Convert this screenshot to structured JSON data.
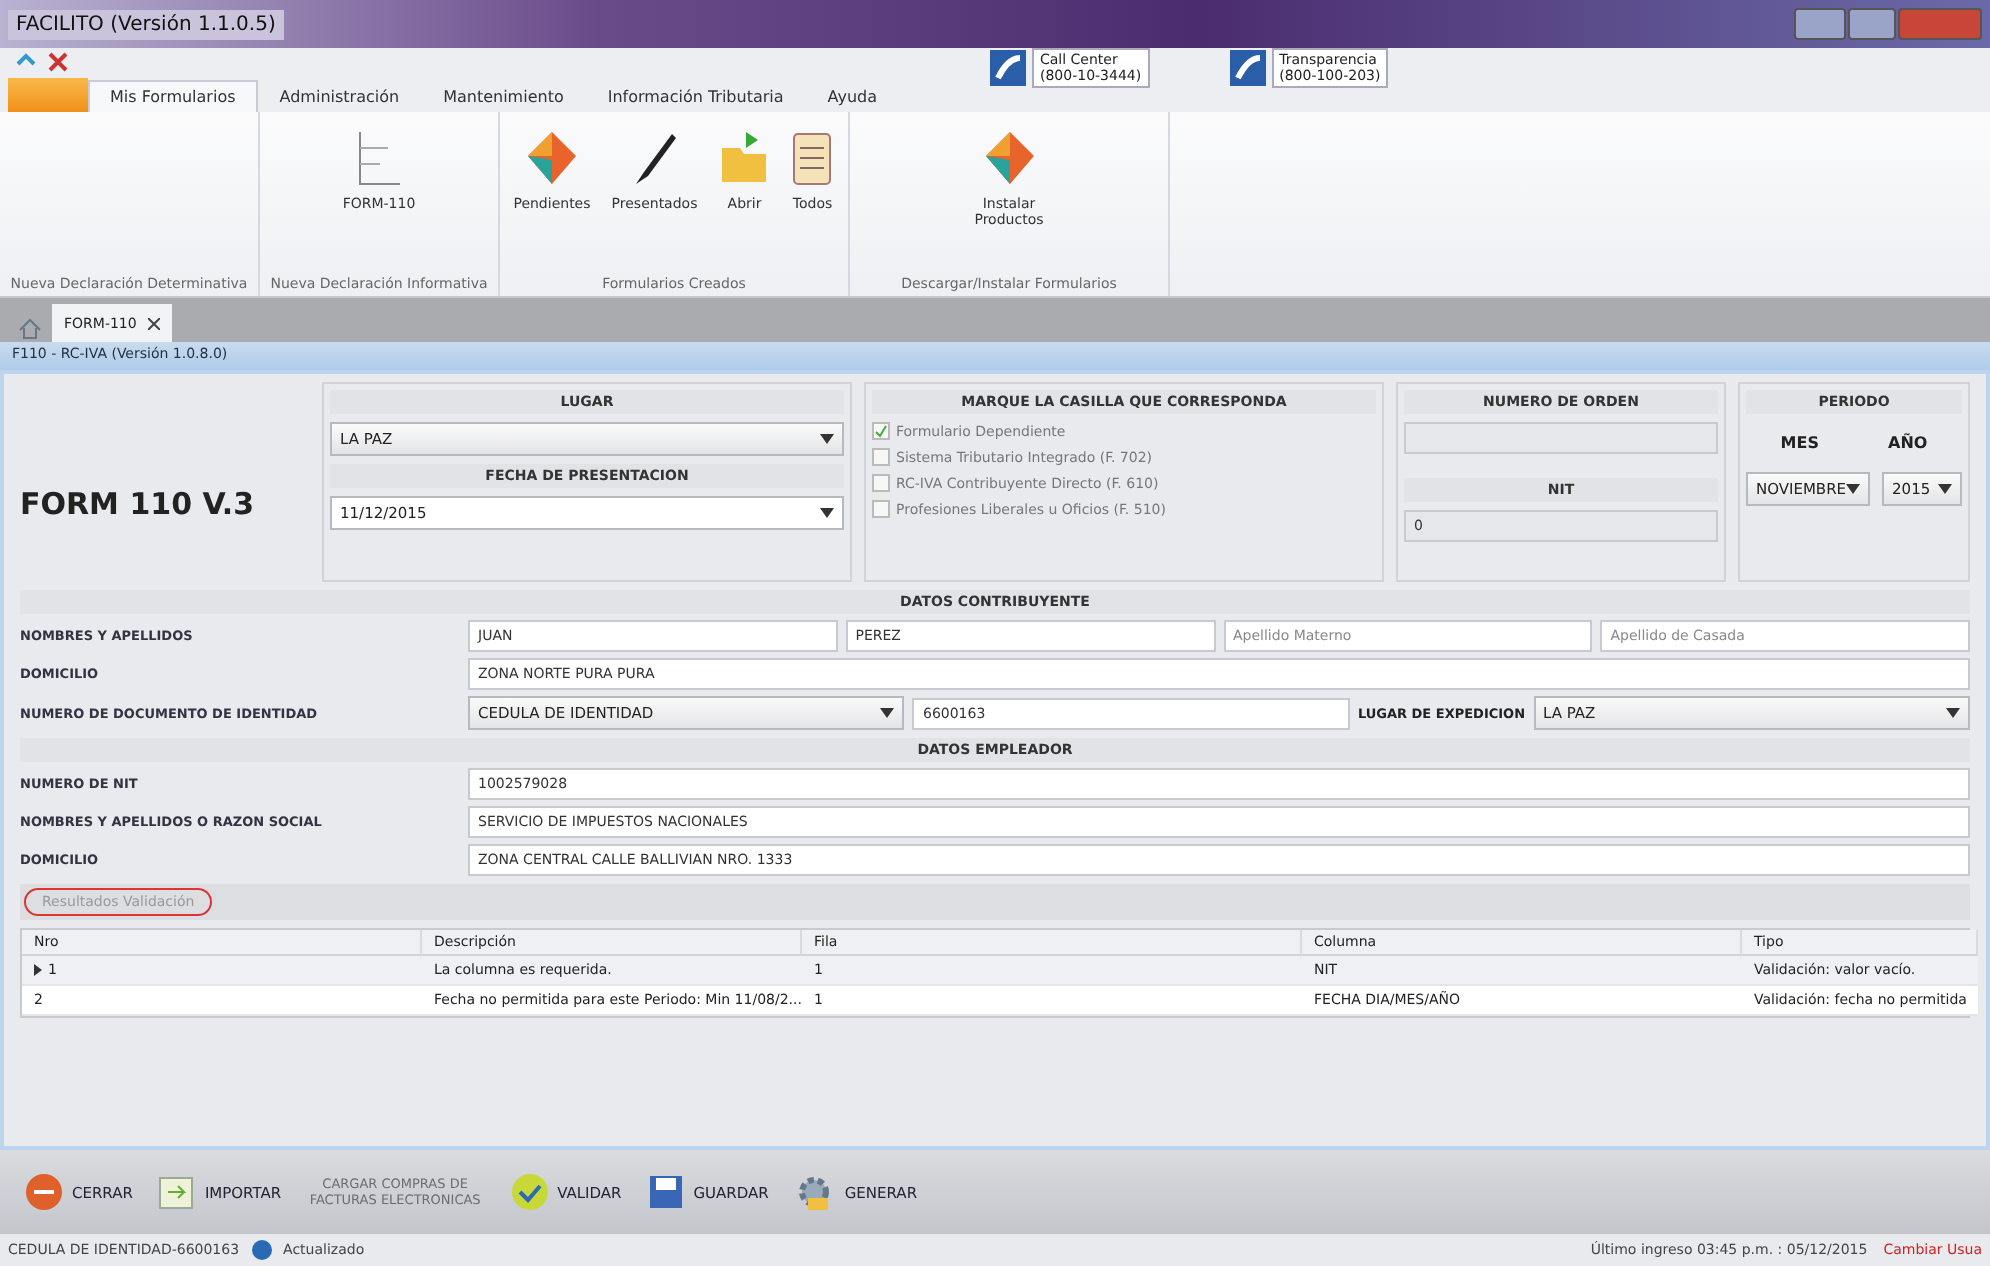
{
  "window": {
    "title": "FACILITO (Versión 1.1.0.5)"
  },
  "ribbon_tabs": [
    {
      "label": "Mis Formularios",
      "selected": true
    },
    {
      "label": "Administración",
      "selected": false
    },
    {
      "label": "Mantenimiento",
      "selected": false
    },
    {
      "label": "Información Tributaria",
      "selected": false
    },
    {
      "label": "Ayuda",
      "selected": false
    }
  ],
  "contacts": [
    {
      "title": "Call Center",
      "phone": "(800-10-3444)"
    },
    {
      "title": "Transparencia",
      "phone": "(800-100-203)"
    }
  ],
  "ribbon_groups": [
    {
      "label": "Nueva Declaración Determinativa"
    },
    {
      "label": "Nueva Declaración Informativa",
      "buttons": [
        {
          "label": "FORM-110",
          "kind": "form"
        }
      ]
    },
    {
      "label": "Formularios Creados",
      "buttons": [
        {
          "label": "Pendientes",
          "kind": "diamond"
        },
        {
          "label": "Presentados",
          "kind": "pen"
        },
        {
          "label": "Abrir",
          "kind": "folder"
        },
        {
          "label": "Todos",
          "kind": "list"
        }
      ]
    },
    {
      "label": "Descargar/Instalar Formularios",
      "buttons": [
        {
          "label": "Instalar Productos",
          "kind": "diamond"
        }
      ]
    }
  ],
  "doc_tabs": [
    {
      "label": "FORM-110",
      "selected": true
    }
  ],
  "form_header": "F110 - RC-IVA (Versión 1.0.8.0)",
  "form": {
    "title": "FORM 110 V.3",
    "lugar": {
      "label": "LUGAR",
      "value": "LA PAZ"
    },
    "fecha": {
      "label": "FECHA DE PRESENTACION",
      "value": "11/12/2015"
    },
    "casillas": {
      "label": "MARQUE LA CASILLA QUE CORRESPONDA",
      "options": [
        {
          "label": "Formulario Dependiente",
          "checked": true
        },
        {
          "label": "Sistema Tributario Integrado (F. 702)",
          "checked": false
        },
        {
          "label": "RC-IVA Contribuyente Directo (F. 610)",
          "checked": false
        },
        {
          "label": "Profesiones Liberales u Oficios (F. 510)",
          "checked": false
        }
      ]
    },
    "orden": {
      "label": "NUMERO DE ORDEN"
    },
    "nit": {
      "label": "NIT",
      "value": "0"
    },
    "periodo": {
      "label": "PERIODO",
      "mes_label": "MES",
      "anio_label": "AÑO",
      "mes": "NOVIEMBRE",
      "anio": "2015"
    }
  },
  "contribuyente": {
    "title": "DATOS CONTRIBUYENTE",
    "rows": [
      {
        "label": "NOMBRES Y APELLIDOS",
        "fields": [
          {
            "kind": "text",
            "value": "JUAN"
          },
          {
            "kind": "text",
            "value": "PEREZ"
          },
          {
            "kind": "text",
            "placeholder": "Apellido Materno"
          },
          {
            "kind": "text",
            "placeholder": "Apellido de Casada"
          }
        ]
      },
      {
        "label": "DOMICILIO",
        "fields": [
          {
            "kind": "text",
            "value": "ZONA NORTE PURA PURA"
          }
        ]
      },
      {
        "label": "NUMERO DE DOCUMENTO DE IDENTIDAD",
        "fields": [
          {
            "kind": "select",
            "value": "CEDULA DE IDENTIDAD"
          },
          {
            "kind": "text",
            "value": "6600163"
          },
          {
            "kind": "label",
            "value": "LUGAR DE EXPEDICION"
          },
          {
            "kind": "select",
            "value": "LA PAZ"
          }
        ]
      }
    ]
  },
  "empleador": {
    "title": "DATOS EMPLEADOR",
    "rows": [
      {
        "label": "NUMERO DE NIT",
        "fields": [
          {
            "kind": "text",
            "value": "1002579028"
          }
        ]
      },
      {
        "label": "NOMBRES Y APELLIDOS O RAZON SOCIAL",
        "fields": [
          {
            "kind": "text",
            "value": "SERVICIO DE IMPUESTOS NACIONALES"
          }
        ]
      },
      {
        "label": "DOMICILIO",
        "fields": [
          {
            "kind": "text",
            "value": "ZONA CENTRAL CALLE BALLIVIAN NRO. 1333"
          }
        ]
      }
    ]
  },
  "validation": {
    "title": "Resultados Validación",
    "columns": [
      "Nro",
      "Descripción",
      "Fila",
      "Columna",
      "Tipo"
    ],
    "rows": [
      {
        "selected": true,
        "cells": [
          "1",
          "La columna es requerida.",
          "1",
          "NIT",
          "Validación: valor vacío."
        ]
      },
      {
        "selected": false,
        "cells": [
          "2",
          "Fecha no permitida para este Periodo: Min 11/08/2...",
          "1",
          "FECHA DIA/MES/AÑO",
          "Validación: fecha no permitida"
        ]
      }
    ]
  },
  "toolbar": [
    {
      "label": "CERRAR",
      "kind": "close",
      "disabled": false
    },
    {
      "label": "IMPORTAR",
      "kind": "import",
      "disabled": false
    },
    {
      "label": "CARGAR COMPRAS DE FACTURAS ELECTRONICAS",
      "kind": "none",
      "disabled": true
    },
    {
      "label": "VALIDAR",
      "kind": "check",
      "disabled": false
    },
    {
      "label": "GUARDAR",
      "kind": "save",
      "disabled": false
    },
    {
      "label": "GENERAR",
      "kind": "generate",
      "disabled": false
    }
  ],
  "status_bar": {
    "document": "CEDULA DE IDENTIDAD-6600163",
    "update": "Actualizado",
    "last_login": "Último ingreso 03:45 p.m. : 05/12/2015",
    "change_user": "Cambiar Usua"
  }
}
